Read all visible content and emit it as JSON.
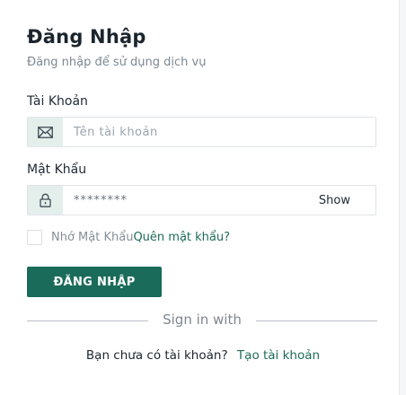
{
  "header": {
    "title": "Đăng Nhập",
    "subtitle": "Đăng nhập để sử dụng dịch vụ"
  },
  "username": {
    "label": "Tài Khoản",
    "placeholder": "Tên tài khoản",
    "icon": "mail-icon"
  },
  "password": {
    "label": "Mật Khẩu",
    "placeholder": "********",
    "icon": "lock-icon",
    "toggle_label": "Show"
  },
  "remember": {
    "label": "Nhớ Mật Khẩu",
    "checked": false
  },
  "forgot_label": "Quên mật khẩu?",
  "submit_label": "ĐĂNG NHẬP",
  "divider_text": "Sign in with",
  "signup": {
    "question": "Bạn chưa có tài khoản?",
    "link_label": "Tạo tài khoản"
  },
  "colors": {
    "accent": "#1a6b5a",
    "addon_bg": "#e4efec"
  }
}
